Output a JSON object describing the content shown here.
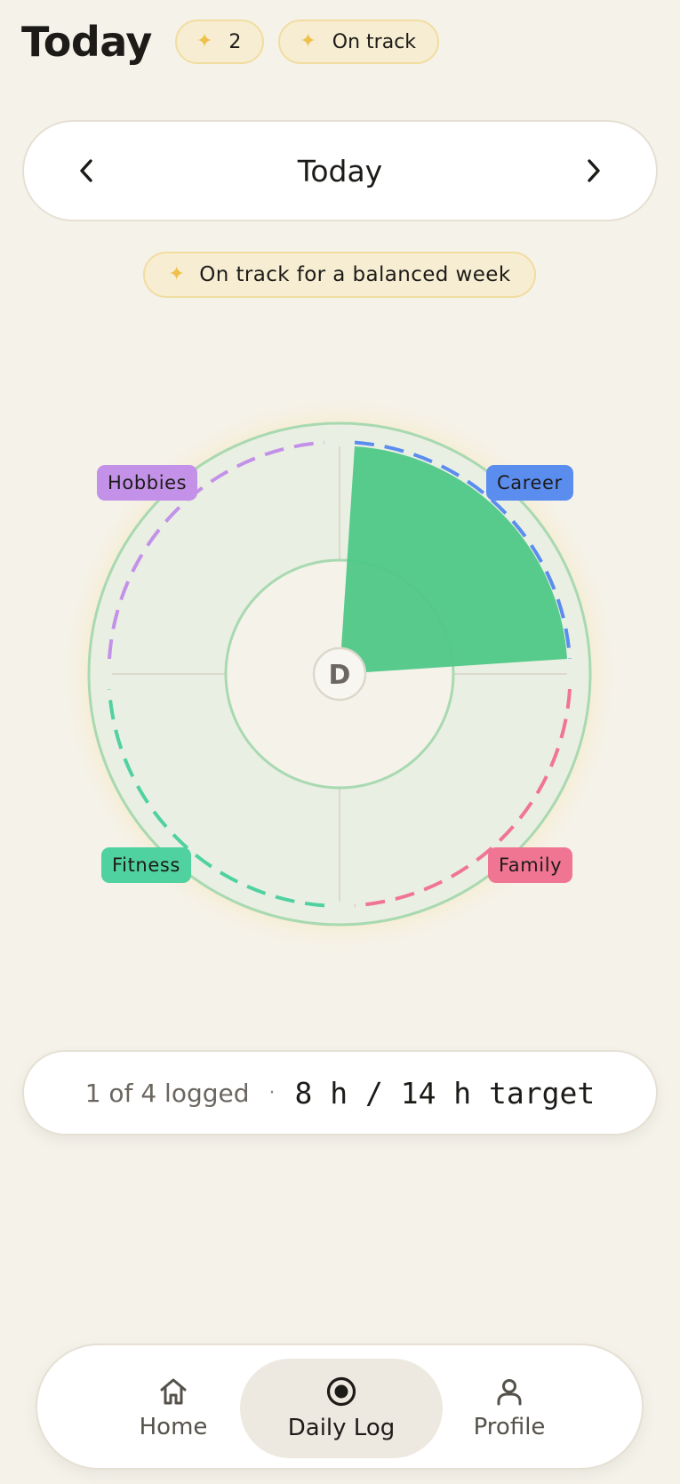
{
  "header": {
    "title": "Today",
    "streak_count": "2",
    "status_badge": "On track"
  },
  "date_nav": {
    "label": "Today"
  },
  "status_message": "On track for a balanced week",
  "wheel": {
    "center_label": "D",
    "categories": [
      {
        "name": "Career",
        "color": "#5b8def",
        "logged": true
      },
      {
        "name": "Family",
        "color": "#f07593",
        "logged": false
      },
      {
        "name": "Fitness",
        "color": "#4fd1a0",
        "logged": false
      },
      {
        "name": "Hobbies",
        "color": "#c392e8",
        "logged": false
      }
    ],
    "fill_color": "#4fc887",
    "ring_color": "#a8d9b0"
  },
  "summary": {
    "logged": "1 of 4 logged",
    "separator": "·",
    "hours": "8 h / 14 h target"
  },
  "bottom_nav": {
    "items": [
      {
        "label": "Home",
        "icon": "home-icon",
        "active": false
      },
      {
        "label": "Daily Log",
        "icon": "record-icon",
        "active": true
      },
      {
        "label": "Profile",
        "icon": "user-icon",
        "active": false
      }
    ]
  }
}
